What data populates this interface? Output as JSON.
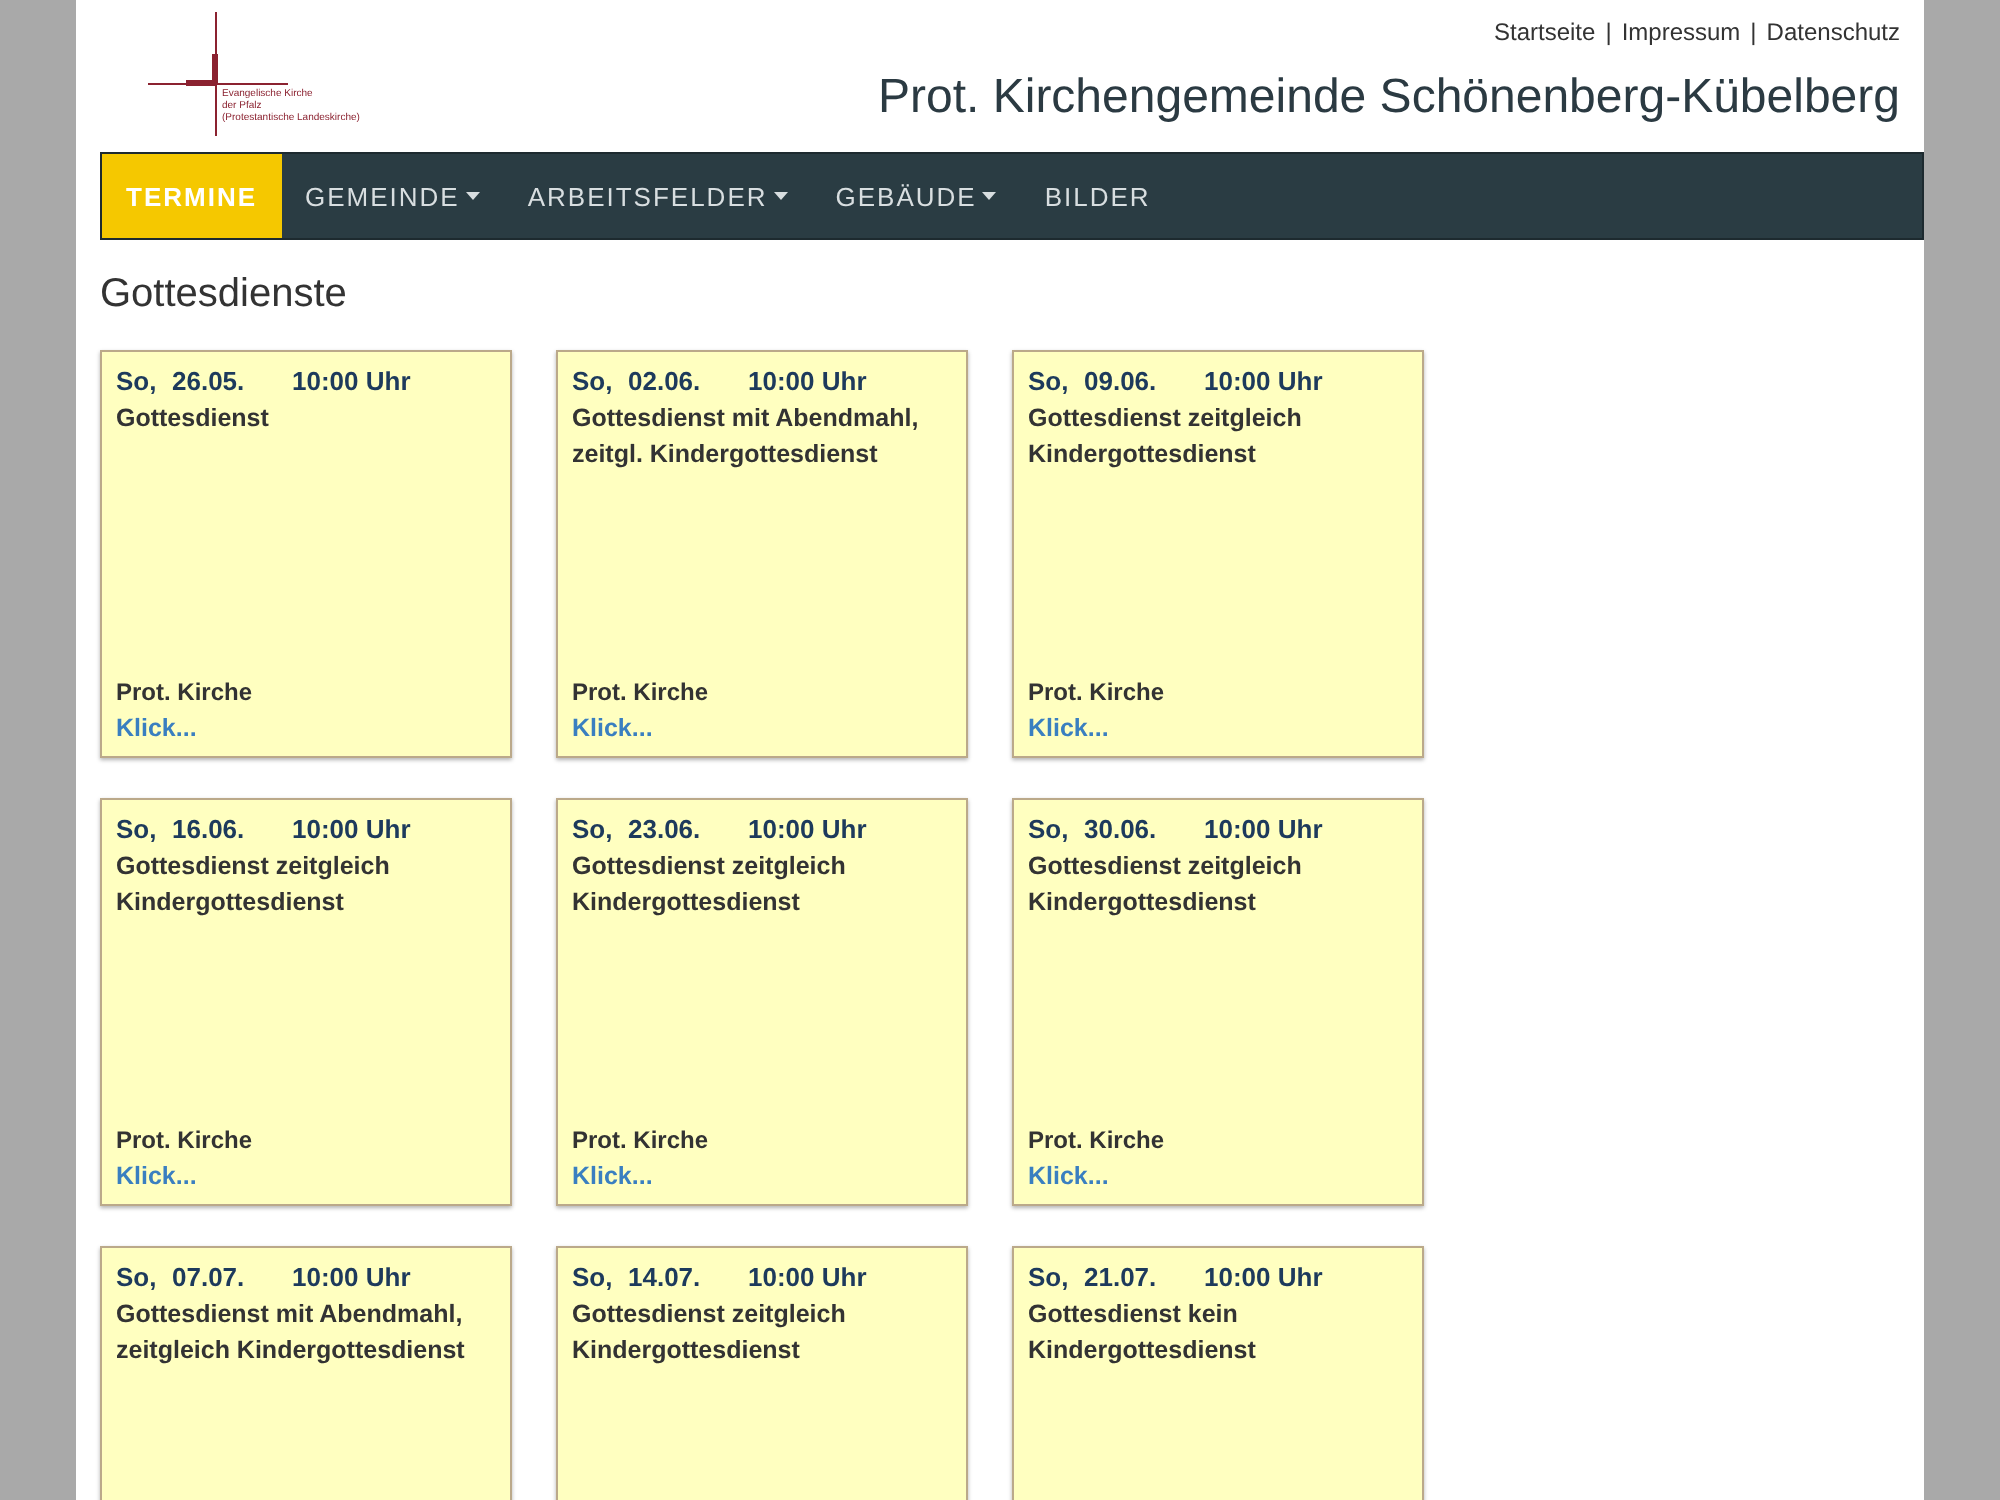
{
  "logo": {
    "lines": [
      "Evangelische Kirche",
      "der Pfalz",
      "(Protestantische Landeskirche)"
    ]
  },
  "top_links": [
    "Startseite",
    "Impressum",
    "Datenschutz"
  ],
  "separator": "|",
  "site_title": "Prot. Kirchengemeinde Schönenberg-Kübelberg",
  "nav": [
    {
      "label": "TERMINE",
      "selected": true,
      "dropdown": false
    },
    {
      "label": "GEMEINDE",
      "selected": false,
      "dropdown": true
    },
    {
      "label": "ARBEITSFELDER",
      "selected": false,
      "dropdown": true
    },
    {
      "label": "GEBÄUDE",
      "selected": false,
      "dropdown": true
    },
    {
      "label": "BILDER",
      "selected": false,
      "dropdown": false
    }
  ],
  "heading": "Gottesdienste",
  "events": [
    {
      "weekday": "So,",
      "date": "26.05.",
      "time": "10:00 Uhr",
      "title": "Gottesdienst",
      "place": "Prot. Kirche",
      "link": "Klick",
      "more": "..."
    },
    {
      "weekday": "So,",
      "date": "02.06.",
      "time": "10:00 Uhr",
      "title": "Gottesdienst mit Abendmahl, zeitgl. Kindergottesdienst",
      "place": "Prot. Kirche",
      "link": "Klick",
      "more": "..."
    },
    {
      "weekday": "So,",
      "date": "09.06.",
      "time": "10:00 Uhr",
      "title": "Gottesdienst zeitgleich Kindergottesdienst",
      "place": "Prot. Kirche",
      "link": "Klick",
      "more": "..."
    },
    {
      "weekday": "So,",
      "date": "16.06.",
      "time": "10:00 Uhr",
      "title": "Gottesdienst zeitgleich Kindergottesdienst",
      "place": "Prot. Kirche",
      "link": "Klick",
      "more": "..."
    },
    {
      "weekday": "So,",
      "date": "23.06.",
      "time": "10:00 Uhr",
      "title": "Gottesdienst zeitgleich Kindergottesdienst",
      "place": "Prot. Kirche",
      "link": "Klick",
      "more": "..."
    },
    {
      "weekday": "So,",
      "date": "30.06.",
      "time": "10:00 Uhr",
      "title": "Gottesdienst zeitgleich Kindergottesdienst",
      "place": "Prot. Kirche",
      "link": "Klick",
      "more": "..."
    },
    {
      "weekday": "So,",
      "date": "07.07.",
      "time": "10:00 Uhr",
      "title": "Gottesdienst mit Abendmahl, zeitgleich Kindergottesdienst"
    },
    {
      "weekday": "So,",
      "date": "14.07.",
      "time": "10:00 Uhr",
      "title": "Gottesdienst zeitgleich Kindergottesdienst"
    },
    {
      "weekday": "So,",
      "date": "21.07.",
      "time": "10:00 Uhr",
      "title": "Gottesdienst kein Kindergottesdienst"
    }
  ]
}
